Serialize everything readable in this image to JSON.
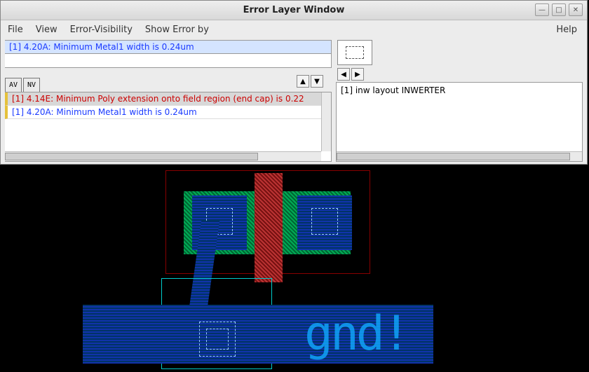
{
  "titlebar": {
    "title": "Error Layer Window"
  },
  "menu": {
    "file": "File",
    "view": "View",
    "error_visibility": "Error-Visibility",
    "show_error_by": "Show Error by",
    "help": "Help"
  },
  "top_list": {
    "items": [
      "[1] 4.20A: Minimum Metal1 width is 0.24um"
    ]
  },
  "tabs": {
    "av": "AV",
    "nv": "NV"
  },
  "arrows": {
    "up": "▲",
    "down": "▼"
  },
  "bottom_list": {
    "items": [
      {
        "text": "[1] 4.14E: Minimum Poly extension onto field region (end cap) is 0.22",
        "cls": "red"
      },
      {
        "text": "[1] 4.20A: Minimum Metal1 width is 0.24um",
        "cls": "blue"
      }
    ]
  },
  "nav": {
    "left": "◀",
    "right": "▶"
  },
  "tree": {
    "root": "[1] inw layout INWERTER"
  },
  "layout": {
    "net_label": "gnd!"
  }
}
